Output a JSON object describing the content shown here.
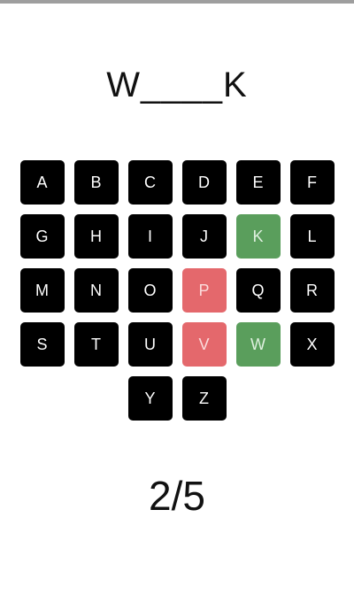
{
  "puzzle": {
    "word_display": "W____K"
  },
  "keyboard": {
    "rows": [
      [
        {
          "letter": "A",
          "state": "default"
        },
        {
          "letter": "B",
          "state": "default"
        },
        {
          "letter": "C",
          "state": "default"
        },
        {
          "letter": "D",
          "state": "default"
        },
        {
          "letter": "E",
          "state": "default"
        },
        {
          "letter": "F",
          "state": "default"
        }
      ],
      [
        {
          "letter": "G",
          "state": "default"
        },
        {
          "letter": "H",
          "state": "default"
        },
        {
          "letter": "I",
          "state": "default"
        },
        {
          "letter": "J",
          "state": "default"
        },
        {
          "letter": "K",
          "state": "correct"
        },
        {
          "letter": "L",
          "state": "default"
        }
      ],
      [
        {
          "letter": "M",
          "state": "default"
        },
        {
          "letter": "N",
          "state": "default"
        },
        {
          "letter": "O",
          "state": "default"
        },
        {
          "letter": "P",
          "state": "wrong"
        },
        {
          "letter": "Q",
          "state": "default"
        },
        {
          "letter": "R",
          "state": "default"
        }
      ],
      [
        {
          "letter": "S",
          "state": "default"
        },
        {
          "letter": "T",
          "state": "default"
        },
        {
          "letter": "U",
          "state": "default"
        },
        {
          "letter": "V",
          "state": "wrong"
        },
        {
          "letter": "W",
          "state": "correct"
        },
        {
          "letter": "X",
          "state": "default"
        }
      ],
      [
        {
          "letter": "Y",
          "state": "default"
        },
        {
          "letter": "Z",
          "state": "default"
        }
      ]
    ]
  },
  "status": {
    "score": "2/5"
  },
  "colors": {
    "key_default": "#000000",
    "key_correct": "#5a9e5c",
    "key_wrong": "#e4686c",
    "top_bar": "#9e9e9e"
  }
}
